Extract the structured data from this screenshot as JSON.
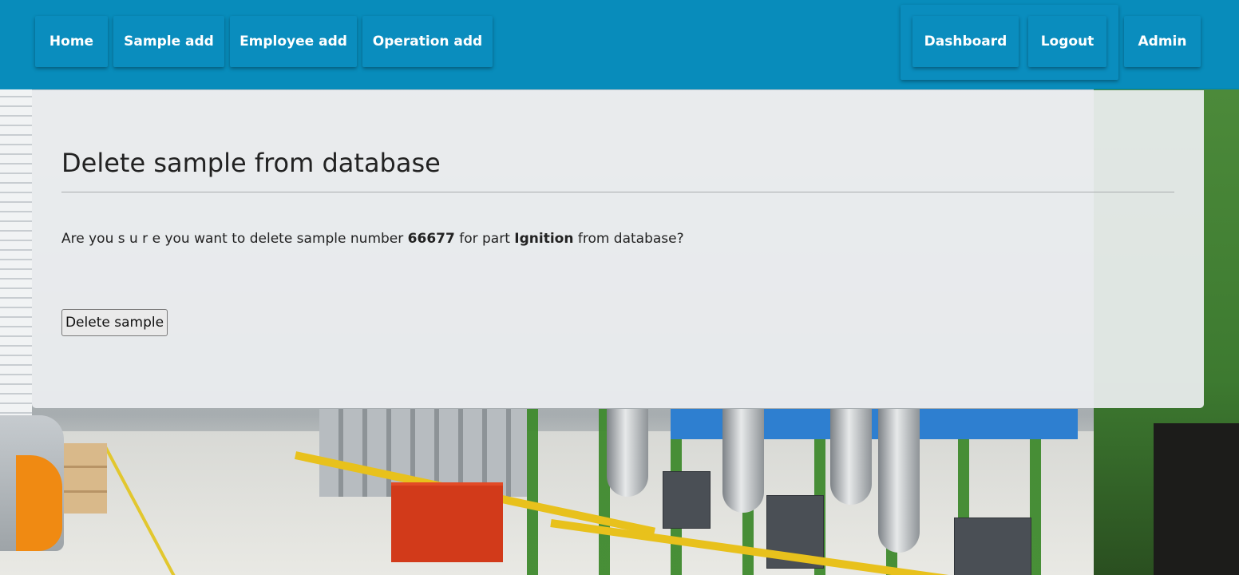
{
  "nav": {
    "left": [
      {
        "label": "Home"
      },
      {
        "label": "Sample add"
      },
      {
        "label": "Employee add"
      },
      {
        "label": "Operation add"
      }
    ],
    "right": [
      {
        "label": "Dashboard"
      },
      {
        "label": "Logout"
      },
      {
        "label": "Admin"
      }
    ]
  },
  "main": {
    "title": "Delete sample from database",
    "question": {
      "prefix": "Are you s u r e you want to delete sample number ",
      "sample_number": "66677",
      "middle": " for part ",
      "part_name": "Ignition",
      "suffix": " from database?"
    },
    "delete_button_label": "Delete sample"
  },
  "colors": {
    "navbar": "#0089ba",
    "nav_button": "#0a8dbe",
    "nav_text": "#ffffff",
    "panel": "#eceef0"
  }
}
